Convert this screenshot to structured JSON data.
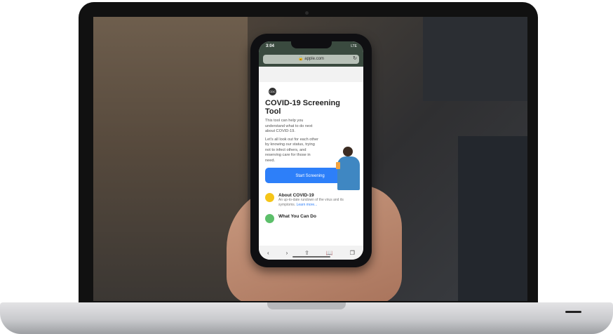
{
  "phone": {
    "status": {
      "time": "3:04",
      "signal": "LTE"
    },
    "url": "apple.com",
    "page": {
      "title": "COVID-19 Screening Tool",
      "intro": "This tool can help you understand what to do next about COVID-19.",
      "body": "Let's all look out for each other by knowing our status, trying not to infect others, and reserving care for those in need.",
      "cta": "Start Screening",
      "items": [
        {
          "title": "About COVID-19",
          "desc": "An up-to-date rundown of the virus and its symptoms.",
          "link": "Learn more...",
          "color": "#f5c518"
        },
        {
          "title": "What You Can Do",
          "desc": "",
          "link": "",
          "color": "#5cbf6a"
        }
      ]
    },
    "toolbar": {
      "back": "‹",
      "forward": "›",
      "share": "⇪",
      "bookmarks": "📖",
      "tabs": "❐"
    }
  }
}
